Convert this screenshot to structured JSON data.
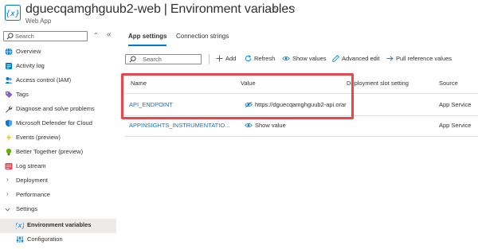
{
  "header": {
    "resource_name": "dguecqamghguub2-web",
    "page_name": "Environment variables",
    "subtitle": "Web App",
    "icon": "environment-variables-icon"
  },
  "sidebar": {
    "search_placeholder": "Search",
    "items": [
      {
        "label": "Overview",
        "icon": "globe-icon",
        "type": "item"
      },
      {
        "label": "Activity log",
        "icon": "activity-log-icon",
        "type": "item"
      },
      {
        "label": "Access control (IAM)",
        "icon": "people-icon",
        "type": "item"
      },
      {
        "label": "Tags",
        "icon": "tag-icon",
        "type": "item"
      },
      {
        "label": "Diagnose and solve problems",
        "icon": "wrench-icon",
        "type": "item"
      },
      {
        "label": "Microsoft Defender for Cloud",
        "icon": "shield-icon",
        "type": "item"
      },
      {
        "label": "Events (preview)",
        "icon": "lightning-icon",
        "type": "item"
      },
      {
        "label": "Better Together (preview)",
        "icon": "lightbulb-icon",
        "type": "item"
      },
      {
        "label": "Log stream",
        "icon": "log-stream-icon",
        "type": "item"
      },
      {
        "label": "Deployment",
        "icon": "chevron-right-icon",
        "type": "group"
      },
      {
        "label": "Performance",
        "icon": "chevron-right-icon",
        "type": "group"
      },
      {
        "label": "Settings",
        "icon": "chevron-down-icon",
        "type": "group"
      },
      {
        "label": "Environment variables",
        "icon": "environment-variables-icon",
        "type": "sub",
        "active": true
      },
      {
        "label": "Configuration",
        "icon": "configuration-icon",
        "type": "sub"
      }
    ]
  },
  "tabs": [
    {
      "label": "App settings",
      "active": true
    },
    {
      "label": "Connection strings",
      "active": false
    }
  ],
  "toolbar": {
    "search_placeholder": "Search",
    "add": "Add",
    "refresh": "Refresh",
    "show_values": "Show values",
    "advanced_edit": "Advanced edit",
    "pull_reference_values": "Pull reference values"
  },
  "table": {
    "columns": [
      "Name",
      "Value",
      "Deployment slot setting",
      "Source"
    ],
    "rows": [
      {
        "name": "API_ENDPOINT",
        "value": "https://dguecqamghguub2-api.orar",
        "value_icon": "eye-off-icon",
        "source": "App Service"
      },
      {
        "name": "APPINSIGHTS_INSTRUMENTATIO...",
        "value": "Show value",
        "value_icon": "eye-icon",
        "source": "App Service"
      }
    ]
  },
  "colors": {
    "accent": "#0078d4",
    "highlight_border": "#e5474e",
    "active_item_bg": "#edebe9"
  }
}
